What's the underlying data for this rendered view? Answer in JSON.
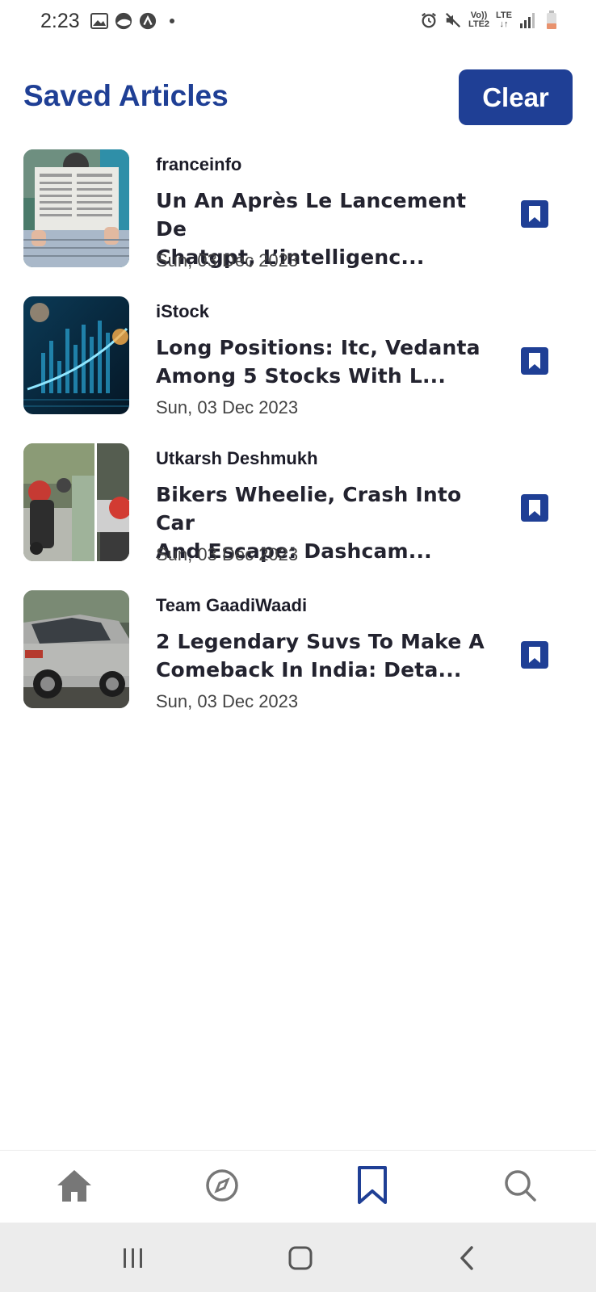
{
  "status_bar": {
    "time": "2:23",
    "left_icons": [
      "image-icon",
      "app-circle-icon",
      "app-a-icon",
      "dot-icon"
    ],
    "right_icons": [
      "alarm-icon",
      "mute-icon",
      "volte-icon",
      "lte-icon",
      "signal-icon",
      "battery-icon"
    ],
    "volte_text": [
      "Vo))",
      "LTE2"
    ],
    "lte_text": [
      "LTE",
      "↓↑"
    ]
  },
  "header": {
    "title": "Saved Articles",
    "clear_label": "Clear"
  },
  "articles": [
    {
      "source": "franceinfo",
      "title_line1": "Un An Après Le Lancement De",
      "title_line2": "Chatgpt, L’intelligenc...",
      "date": "Sun, 03 Dec 2023",
      "thumb": "newspaper-reader-photo"
    },
    {
      "source": "iStock",
      "title_line1": "Long Positions: Itc, Vedanta",
      "title_line2": "Among 5 Stocks With L...",
      "date": "Sun, 03 Dec 2023",
      "thumb": "stock-chart-photo"
    },
    {
      "source": "Utkarsh Deshmukh",
      "title_line1": "Bikers Wheelie, Crash Into Car",
      "title_line2": "And Escape: Dashcam...",
      "date": "Sun, 03 Dec 2023",
      "thumb": "bikers-street-photo"
    },
    {
      "source": "Team GaadiWaadi",
      "title_line1": "2 Legendary Suvs To Make A",
      "title_line2": "Comeback In India: Deta...",
      "date": "Sun, 03 Dec 2023",
      "thumb": "silver-suv-photo"
    }
  ],
  "bottom_nav": {
    "items": [
      "home-icon",
      "compass-icon",
      "bookmark-icon",
      "search-icon"
    ],
    "active": "bookmark-icon"
  },
  "system_nav": [
    "recents-icon",
    "home-square-icon",
    "back-icon"
  ],
  "colors": {
    "accent": "#1f3f95",
    "nav_inactive": "#777777",
    "system_bar": "#ececec"
  }
}
